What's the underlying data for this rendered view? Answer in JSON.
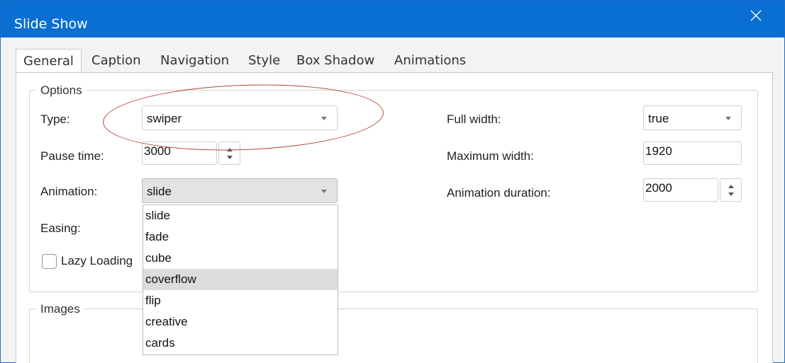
{
  "window": {
    "title": "Slide Show"
  },
  "tabs": [
    {
      "label": "General",
      "active": true
    },
    {
      "label": "Caption"
    },
    {
      "label": "Navigation"
    },
    {
      "label": "Style"
    },
    {
      "label": "Box Shadow"
    },
    {
      "label": "Animations"
    }
  ],
  "options": {
    "group_title": "Options",
    "type_label": "Type:",
    "type_value": "swiper",
    "pause_label": "Pause time:",
    "pause_value": "3000",
    "animation_label": "Animation:",
    "animation_value": "slide",
    "easing_label": "Easing:",
    "lazy_label": "Lazy Loading",
    "fullwidth_label": "Full width:",
    "fullwidth_value": "true",
    "maxwidth_label": "Maximum width:",
    "maxwidth_value": "1920",
    "duration_label": "Animation duration:",
    "duration_value": "2000"
  },
  "animation_options": [
    "slide",
    "fade",
    "cube",
    "coverflow",
    "flip",
    "creative",
    "cards"
  ],
  "animation_highlighted": "coverflow",
  "images": {
    "group_title": "Images"
  },
  "colors": {
    "titlebar": "#0a6fd2",
    "annotation": "#b3463b",
    "highlight": "#dcdcdc"
  },
  "icons": {
    "close": "close-icon",
    "dropdown": "chevron-down-icon",
    "spinner": "spinner-arrows-icon"
  }
}
